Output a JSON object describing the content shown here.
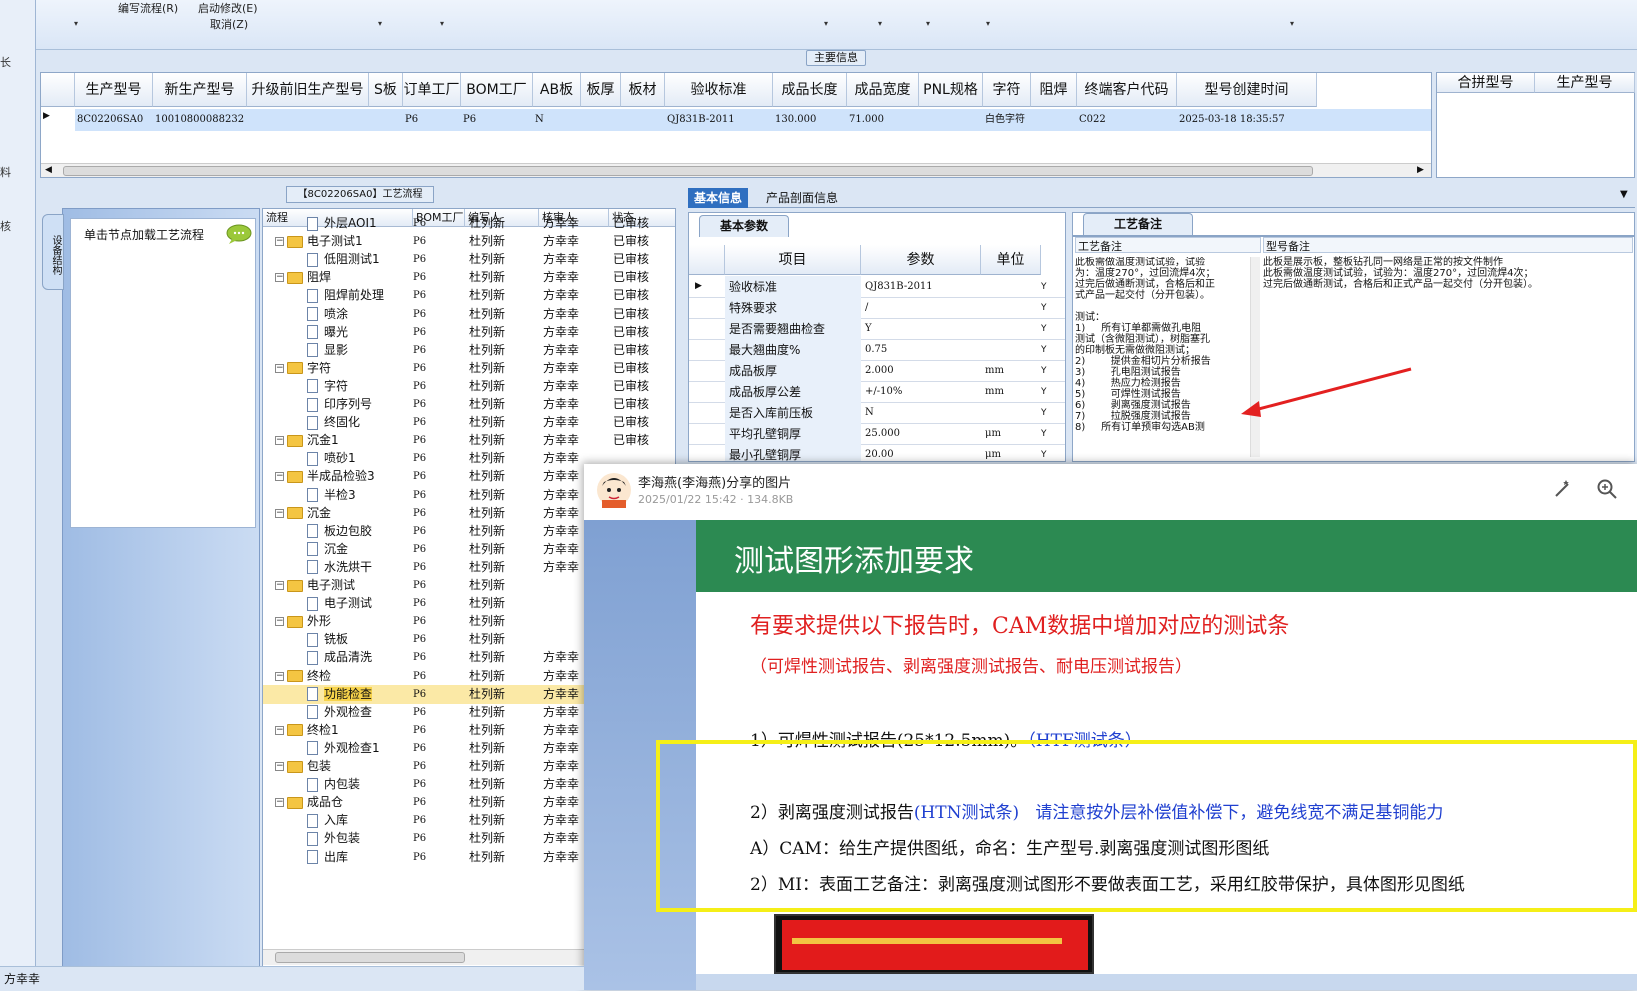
{
  "toolbar": {
    "write_flow": "编写流程(R)",
    "start_modify": "启动修改(E)",
    "cancel": "取消(Z)"
  },
  "left_strip": [
    "长",
    "料",
    "核"
  ],
  "main_info": {
    "title": "主要信息",
    "columns": [
      "生产型号",
      "新生产型号",
      "升级前旧生产型号",
      "S板",
      "订单工厂",
      "BOM工厂",
      "AB板",
      "板厚",
      "板材",
      "验收标准",
      "成品长度",
      "成品宽度",
      "PNL规格",
      "字符",
      "阻焊",
      "终端客户代码",
      "型号创建时间"
    ],
    "row": [
      "8C02206SA0",
      "10010800088232",
      "",
      "",
      "P6",
      "P6",
      "N",
      "",
      "",
      "QJ831B-2011",
      "130.000",
      "71.000",
      "",
      "白色字符",
      "",
      "C022",
      "2025-03-18 18:35:57"
    ],
    "merge_columns": [
      "合拼型号",
      "生产型号"
    ]
  },
  "process": {
    "title": "【8C02206SA0】工艺流程",
    "side_tab": "设备结构",
    "side_label": "单击节点加载工艺流程",
    "columns": [
      "流程",
      "BOM工厂",
      "编写人",
      "核审人",
      "状态"
    ],
    "rows": [
      {
        "level": 1,
        "type": "doc",
        "name": "外层AOI1",
        "bom": "P6",
        "writer": "杜列新",
        "reviewer": "方幸幸",
        "status": "已审核"
      },
      {
        "level": 0,
        "type": "folder",
        "name": "电子测试1",
        "bom": "P6",
        "writer": "杜列新",
        "reviewer": "方幸幸",
        "status": "已审核"
      },
      {
        "level": 1,
        "type": "doc",
        "name": "低阻测试1",
        "bom": "P6",
        "writer": "杜列新",
        "reviewer": "方幸幸",
        "status": "已审核"
      },
      {
        "level": 0,
        "type": "folder",
        "name": "阻焊",
        "bom": "P6",
        "writer": "杜列新",
        "reviewer": "方幸幸",
        "status": "已审核"
      },
      {
        "level": 1,
        "type": "doc",
        "name": "阻焊前处理",
        "bom": "P6",
        "writer": "杜列新",
        "reviewer": "方幸幸",
        "status": "已审核"
      },
      {
        "level": 1,
        "type": "doc",
        "name": "喷涂",
        "bom": "P6",
        "writer": "杜列新",
        "reviewer": "方幸幸",
        "status": "已审核"
      },
      {
        "level": 1,
        "type": "doc",
        "name": "曝光",
        "bom": "P6",
        "writer": "杜列新",
        "reviewer": "方幸幸",
        "status": "已审核"
      },
      {
        "level": 1,
        "type": "doc",
        "name": "显影",
        "bom": "P6",
        "writer": "杜列新",
        "reviewer": "方幸幸",
        "status": "已审核"
      },
      {
        "level": 0,
        "type": "folder",
        "name": "字符",
        "bom": "P6",
        "writer": "杜列新",
        "reviewer": "方幸幸",
        "status": "已审核"
      },
      {
        "level": 1,
        "type": "doc",
        "name": "字符",
        "bom": "P6",
        "writer": "杜列新",
        "reviewer": "方幸幸",
        "status": "已审核"
      },
      {
        "level": 1,
        "type": "doc",
        "name": "印序列号",
        "bom": "P6",
        "writer": "杜列新",
        "reviewer": "方幸幸",
        "status": "已审核"
      },
      {
        "level": 1,
        "type": "doc",
        "name": "终固化",
        "bom": "P6",
        "writer": "杜列新",
        "reviewer": "方幸幸",
        "status": "已审核"
      },
      {
        "level": 0,
        "type": "folder",
        "name": "沉金1",
        "bom": "P6",
        "writer": "杜列新",
        "reviewer": "方幸幸",
        "status": "已审核"
      },
      {
        "level": 1,
        "type": "doc",
        "name": "喷砂1",
        "bom": "P6",
        "writer": "杜列新",
        "reviewer": "方幸幸",
        "status": ""
      },
      {
        "level": 0,
        "type": "folder",
        "name": "半成品检验3",
        "bom": "P6",
        "writer": "杜列新",
        "reviewer": "方幸幸",
        "status": ""
      },
      {
        "level": 1,
        "type": "doc",
        "name": "半检3",
        "bom": "P6",
        "writer": "杜列新",
        "reviewer": "方幸幸",
        "status": ""
      },
      {
        "level": 0,
        "type": "folder",
        "name": "沉金",
        "bom": "P6",
        "writer": "杜列新",
        "reviewer": "方幸幸",
        "status": ""
      },
      {
        "level": 1,
        "type": "doc",
        "name": "板边包胶",
        "bom": "P6",
        "writer": "杜列新",
        "reviewer": "方幸幸",
        "status": ""
      },
      {
        "level": 1,
        "type": "doc",
        "name": "沉金",
        "bom": "P6",
        "writer": "杜列新",
        "reviewer": "方幸幸",
        "status": ""
      },
      {
        "level": 1,
        "type": "doc",
        "name": "水洗烘干",
        "bom": "P6",
        "writer": "杜列新",
        "reviewer": "方幸幸",
        "status": ""
      },
      {
        "level": 0,
        "type": "folder",
        "name": "电子测试",
        "bom": "P6",
        "writer": "杜列新",
        "reviewer": "",
        "status": ""
      },
      {
        "level": 1,
        "type": "doc",
        "name": "电子测试",
        "bom": "P6",
        "writer": "杜列新",
        "reviewer": "",
        "status": ""
      },
      {
        "level": 0,
        "type": "folder",
        "name": "外形",
        "bom": "P6",
        "writer": "杜列新",
        "reviewer": "",
        "status": ""
      },
      {
        "level": 1,
        "type": "doc",
        "name": "铣板",
        "bom": "P6",
        "writer": "杜列新",
        "reviewer": "",
        "status": ""
      },
      {
        "level": 1,
        "type": "doc",
        "name": "成品清洗",
        "bom": "P6",
        "writer": "杜列新",
        "reviewer": "方幸幸",
        "status": ""
      },
      {
        "level": 0,
        "type": "folder",
        "name": "终检",
        "bom": "P6",
        "writer": "杜列新",
        "reviewer": "方幸幸",
        "status": ""
      },
      {
        "level": 1,
        "type": "doc",
        "name": "功能检查",
        "bom": "P6",
        "writer": "杜列新",
        "reviewer": "方幸幸",
        "status": "",
        "selected": true
      },
      {
        "level": 1,
        "type": "doc",
        "name": "外观检查",
        "bom": "P6",
        "writer": "杜列新",
        "reviewer": "方幸幸",
        "status": ""
      },
      {
        "level": 0,
        "type": "folder",
        "name": "终检1",
        "bom": "P6",
        "writer": "杜列新",
        "reviewer": "方幸幸",
        "status": ""
      },
      {
        "level": 1,
        "type": "doc",
        "name": "外观检查1",
        "bom": "P6",
        "writer": "杜列新",
        "reviewer": "方幸幸",
        "status": ""
      },
      {
        "level": 0,
        "type": "folder",
        "name": "包装",
        "bom": "P6",
        "writer": "杜列新",
        "reviewer": "方幸幸",
        "status": ""
      },
      {
        "level": 1,
        "type": "doc",
        "name": "内包装",
        "bom": "P6",
        "writer": "杜列新",
        "reviewer": "方幸幸",
        "status": ""
      },
      {
        "level": 0,
        "type": "folder",
        "name": "成品仓",
        "bom": "P6",
        "writer": "杜列新",
        "reviewer": "方幸幸",
        "status": ""
      },
      {
        "level": 1,
        "type": "doc",
        "name": "入库",
        "bom": "P6",
        "writer": "杜列新",
        "reviewer": "方幸幸",
        "status": ""
      },
      {
        "level": 1,
        "type": "doc",
        "name": "外包装",
        "bom": "P6",
        "writer": "杜列新",
        "reviewer": "方幸幸",
        "status": ""
      },
      {
        "level": 1,
        "type": "doc",
        "name": "出库",
        "bom": "P6",
        "writer": "杜列新",
        "reviewer": "方幸幸",
        "status": ""
      }
    ]
  },
  "right_panel": {
    "tabs": [
      "基本信息",
      "产品剖面信息"
    ],
    "params_tab": "基本参数",
    "remarks_tab": "工艺备注",
    "param_columns": [
      "项目",
      "参数",
      "单位"
    ],
    "params": [
      {
        "k": "验收标准",
        "v": "QJ831B-2011",
        "u": "",
        "y": "Y"
      },
      {
        "k": "特殊要求",
        "v": "/",
        "u": "",
        "y": "Y"
      },
      {
        "k": "是否需要翘曲检查",
        "v": "Y",
        "u": "",
        "y": "Y"
      },
      {
        "k": "最大翘曲度%",
        "v": "0.75",
        "u": "",
        "y": "Y"
      },
      {
        "k": "成品板厚",
        "v": "2.000",
        "u": "mm",
        "y": "Y"
      },
      {
        "k": "成品板厚公差",
        "v": "+/-10%",
        "u": "mm",
        "y": "Y"
      },
      {
        "k": "是否入库前压板",
        "v": "N",
        "u": "",
        "y": "Y"
      },
      {
        "k": "平均孔壁铜厚",
        "v": "25.000",
        "u": "μm",
        "y": "Y"
      },
      {
        "k": "最小孔壁铜厚",
        "v": "20.00",
        "u": "μm",
        "y": "Y"
      }
    ],
    "remark_headers": [
      "工艺备注",
      "型号备注"
    ],
    "process_remark": "此板需做温度测试试验，试验\n为：温度270°，过回流焊4次；\n过完后做通断测试，合格后和正\n式产品一起交付（分开包装）。\n\n测试：\n1)     所有订单都需做孔电阻\n测试（含微阻测试），树脂塞孔\n的印制板无需做微阻测试；\n2)        提供金相切片分析报告\n3)        孔电阻测试报告\n4)        热应力检测报告\n5)        可焊性测试报告\n6)        剥离强度测试报告\n7)        拉脱强度测试报告\n8)     所有订单预审勾选AB测",
    "model_remark": "此板是展示板，整板钻孔同一网络是正常的按文件制作\n此板需做温度测试试验，试验为：温度270°，过回流焊4次；\n过完后做通断测试，合格后和正式产品一起交付（分开包装）。"
  },
  "overlay": {
    "sender": "李海燕(李海燕)分享的图片",
    "meta": "2025/01/22 15:42 · 134.8KB",
    "slide_title": "测试图形添加要求",
    "line1": "有要求提供以下报告时，CAM数据中增加对应的测试条",
    "line2": "（可焊性测试报告、剥离强度测试报告、耐电压测试报告）",
    "item1_a": "1）可焊性测试报告(25*12.5mm)。",
    "item1_b": "（HTF测试条）",
    "item2_a": "2）剥离强度测试报告",
    "item2_b": "(HTN测试条)",
    "item2_c": "请注意按外层补偿值补偿下，避免线宽不满足基铜能力",
    "item_a": "A）CAM：给生产提供图纸，命名：生产型号.剥离强度测试图形图纸",
    "item_mi": "2）MI：表面工艺备注：剥离强度测试图形不要做表面工艺，采用红胶带保护，具体图形见图纸"
  },
  "status": {
    "user": "方幸幸"
  }
}
